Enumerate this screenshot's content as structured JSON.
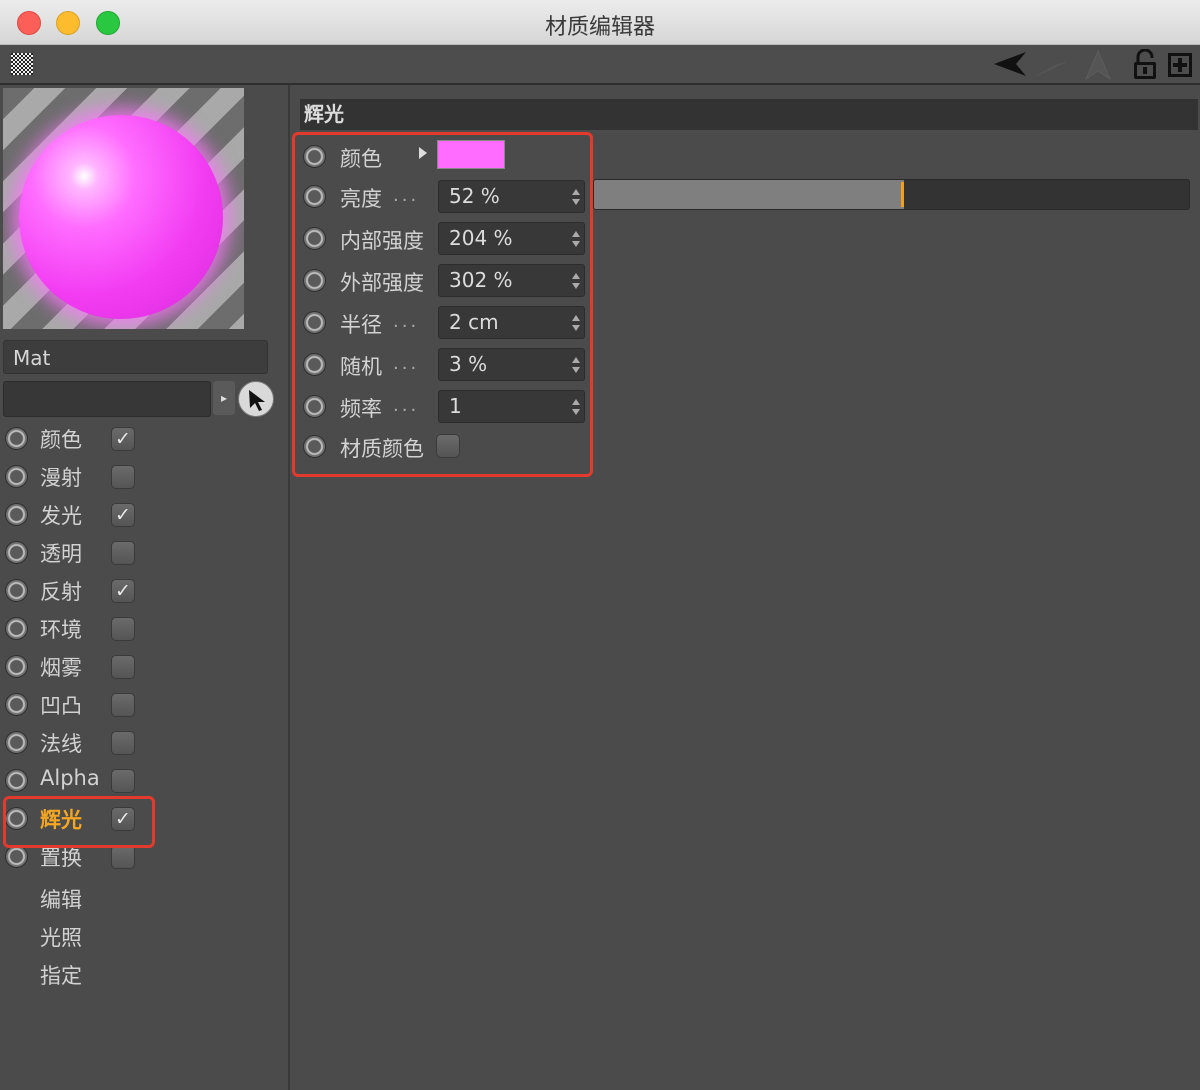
{
  "window": {
    "title": "材质编辑器"
  },
  "toolbar": {
    "icons": [
      "grip-icon",
      "back-arrow-icon",
      "forward-arrow-icon",
      "up-arrow-icon",
      "lock-icon",
      "new-window-icon"
    ]
  },
  "material": {
    "name": "Mat",
    "link_value": ""
  },
  "channels": [
    {
      "label": "颜色",
      "checked": true
    },
    {
      "label": "漫射",
      "checked": false
    },
    {
      "label": "发光",
      "checked": true
    },
    {
      "label": "透明",
      "checked": false
    },
    {
      "label": "反射",
      "checked": true
    },
    {
      "label": "环境",
      "checked": false
    },
    {
      "label": "烟雾",
      "checked": false
    },
    {
      "label": "凹凸",
      "checked": false
    },
    {
      "label": "法线",
      "checked": false
    },
    {
      "label": "Alpha",
      "checked": false
    },
    {
      "label": "辉光",
      "checked": true,
      "active": true
    },
    {
      "label": "置换",
      "checked": false
    }
  ],
  "pages": [
    "编辑",
    "光照",
    "指定"
  ],
  "panel": {
    "title": "辉光",
    "color": {
      "label": "颜色",
      "swatch": "#ff6cff"
    },
    "brightness": {
      "label": "亮度",
      "dots": "...",
      "value": "52 %",
      "slider_fraction": 0.52
    },
    "inner_strength": {
      "label": "内部强度",
      "value": "204 %"
    },
    "outer_strength": {
      "label": "外部强度",
      "value": "302 %"
    },
    "radius": {
      "label": "半径",
      "dots": "...",
      "value": "2 cm"
    },
    "random": {
      "label": "随机",
      "dots": "...",
      "value": "3 %"
    },
    "frequency": {
      "label": "频率",
      "dots": "...",
      "value": "1"
    },
    "material_color": {
      "label": "材质颜色",
      "checked": false
    }
  },
  "colors": {
    "accent_active": "#f5a623",
    "highlight_box": "#e23b2e",
    "glow_color": "#ff6cff"
  }
}
